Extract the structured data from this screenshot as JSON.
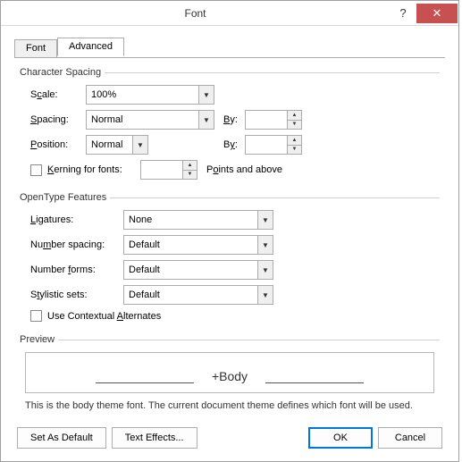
{
  "title": "Font",
  "tabs": {
    "font": "Font",
    "advanced": "Advanced"
  },
  "charspacing": {
    "legend": "Character Spacing",
    "scale_label": "Scale:",
    "scale_value": "100%",
    "spacing_label": "Spacing:",
    "spacing_value": "Normal",
    "by1_label": "By:",
    "by1_value": "",
    "position_label": "Position:",
    "position_value": "Normal",
    "by2_label": "By:",
    "by2_value": "",
    "kerning_label_pre": "Kerning for fonts:",
    "kerning_value": "",
    "kerning_after": "Points and above"
  },
  "opentype": {
    "legend": "OpenType Features",
    "ligatures_label": "Ligatures:",
    "ligatures_value": "None",
    "numspacing_label": "Number spacing:",
    "numspacing_value": "Default",
    "numforms_label": "Number forms:",
    "numforms_value": "Default",
    "stylistic_label": "Stylistic sets:",
    "stylistic_value": "Default",
    "contextual_label": "Use Contextual Alternates"
  },
  "preview": {
    "legend": "Preview",
    "text": "+Body",
    "note": "This is the body theme font. The current document theme defines which font will be used."
  },
  "buttons": {
    "set_default": "Set As Default",
    "text_effects": "Text Effects...",
    "ok": "OK",
    "cancel": "Cancel"
  }
}
